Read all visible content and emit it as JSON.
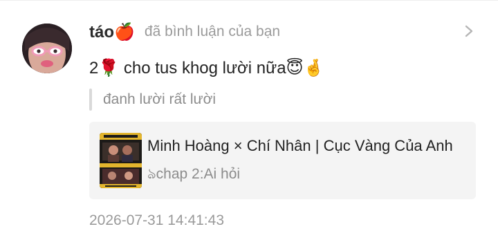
{
  "notification": {
    "username": "táo🍎",
    "action_text": "đã bình luận của bạn",
    "comment_text": "2🌹 cho tus khog lười nữa😇🤞",
    "quoted_text": "đanh lười rất lười",
    "story": {
      "title": "Minh Hoàng × Chí Nhân | Cục Vàng Của Anh",
      "chapter": "ঌchap 2:Ai hỏi"
    },
    "timestamp": "2026-07-31 14:41:43"
  },
  "icons": {
    "avatar": "avatar",
    "chevron": "chevron-right-icon",
    "cover": "story-cover-thumbnail"
  },
  "colors": {
    "muted_text": "#9a9a9a",
    "card_background": "#f4f4f4",
    "quote_bar": "#d9d9d9"
  }
}
